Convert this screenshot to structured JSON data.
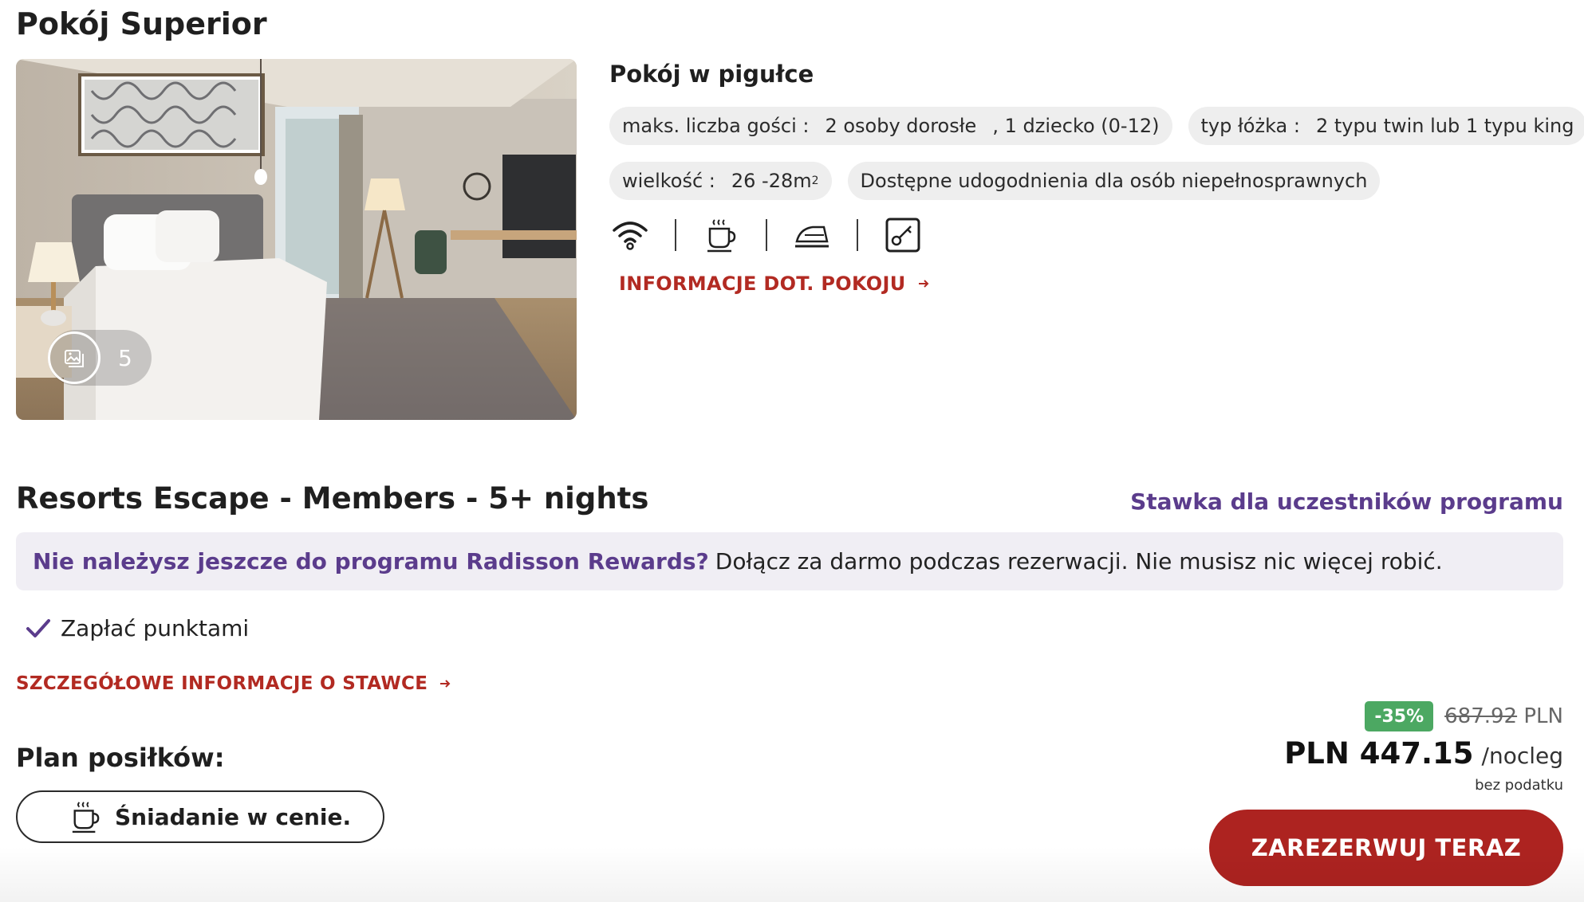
{
  "room": {
    "title": "Pokój Superior",
    "gallery_count": "5"
  },
  "summary": {
    "heading": "Pokój w pigułce",
    "guests_label": "maks. liczba gości :",
    "guests_adults": "2 osoby dorosłe",
    "guests_child": ", 1 dziecko (0-12)",
    "bed_label": "typ łóżka :",
    "bed_value": "2 typu twin lub 1 typu king",
    "size_label": "wielkość :",
    "size_value": "26 -28m",
    "size_unit_sup": "2",
    "accessibility": "Dostępne udogodnienia dla osób niepełnosprawnych",
    "amenity_icons": [
      "wifi-icon",
      "coffee-cup-icon",
      "iron-icon",
      "key-card-icon"
    ],
    "room_info_link": "INFORMACJE DOT. POKOJU"
  },
  "rate": {
    "title": "Resorts Escape - Members - 5+ nights",
    "member_label": "Stawka dla uczestników programu",
    "banner_highlight": "Nie należysz jeszcze do programu Radisson Rewards?",
    "banner_text": "Dołącz za darmo podczas rezerwacji. Nie musisz nic więcej robić.",
    "pay_points": "Zapłać punktami",
    "rate_info_link": "SZCZEGÓŁOWE INFORMACJE O STAWCE",
    "meal_heading": "Plan posiłków:",
    "meal_option": "Śniadanie w cenie."
  },
  "price": {
    "discount": "-35%",
    "old_amount": "687.92",
    "old_currency": "PLN",
    "current": "PLN 447.15",
    "per_night": "/nocleg",
    "tax_note": "bez podatku",
    "book_button": "ZAREZERWUJ TERAZ"
  },
  "colors": {
    "accent_red": "#ad2320",
    "link_red": "#b22a22",
    "purple": "#5b3c8c",
    "discount_green": "#4ca862",
    "chip_bg": "#eeeeee",
    "banner_bg": "#f0eef4"
  }
}
